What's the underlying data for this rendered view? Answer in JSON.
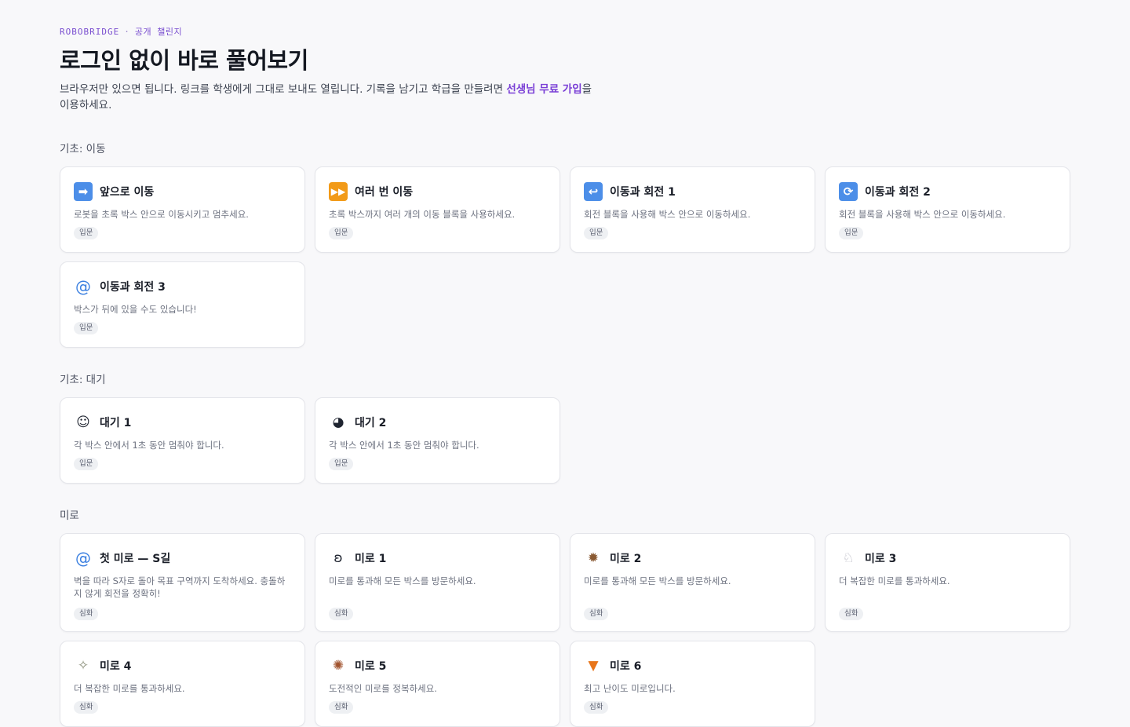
{
  "header": {
    "brand": "ROBOBRIDGE",
    "separator": "·",
    "subtitle": "공개 챌린지",
    "title": "로그인 없이 바로 풀어보기",
    "desc_part1": "브라우저만 있으면 됩니다. 링크를 학생에게 그대로 보내도 열립니다. 기록을 남기고 학급을 만들려면 ",
    "desc_link": "선생님 무료 가입",
    "desc_part2": "을 이용하세요."
  },
  "sections": [
    {
      "title": "기초: 이동",
      "cards": [
        {
          "icon": "right-arrow-icon",
          "glyph": "➡",
          "title": "앞으로 이동",
          "desc": "로봇을 초록 박스 안으로 이동시키고 멈추세요.",
          "badge": "입문"
        },
        {
          "icon": "fast-forward-icon",
          "glyph": "⏩",
          "title": "여러 번 이동",
          "desc": "초록 박스까지 여러 개의 이동 블록을 사용하세요.",
          "badge": "입문"
        },
        {
          "icon": "return-arrow-icon",
          "glyph": "↩",
          "title": "이동과 회전 1",
          "desc": "회전 블록을 사용해 박스 안으로 이동하세요.",
          "badge": "입문"
        },
        {
          "icon": "rotate-arrows-icon",
          "glyph": "🔄",
          "title": "이동과 회전 2",
          "desc": "회전 블록을 사용해 박스 안으로 이동하세요.",
          "badge": "입문"
        },
        {
          "icon": "cyclone-icon",
          "glyph": "🌀",
          "title": "이동과 회전 3",
          "desc": "박스가 뒤에 있을 수도 있습니다!",
          "badge": "입문"
        }
      ]
    },
    {
      "title": "기초: 대기",
      "cards": [
        {
          "icon": "sleeping-face-icon",
          "glyph": "😴",
          "title": "대기 1",
          "desc": "각 박스 안에서 1초 동안 멈춰야 합니다.",
          "badge": "입문"
        },
        {
          "icon": "panda-icon",
          "glyph": "🐼",
          "title": "대기 2",
          "desc": "각 박스 안에서 1초 동안 멈춰야 합니다.",
          "badge": "입문"
        }
      ]
    },
    {
      "title": "미로",
      "cards": [
        {
          "icon": "cyclone-icon",
          "glyph": "🌀",
          "title": "첫 미로 — S길",
          "desc": "벽을 따라 S자로 돌아 목표 구역까지 도착하세요. 충돌하지 않게 회전을 정확히!",
          "badge": "심화"
        },
        {
          "icon": "rabbit-face-icon",
          "glyph": "🐰",
          "title": "미로 1",
          "desc": "미로를 통과해 모든 박스를 방문하세요.",
          "badge": "심화"
        },
        {
          "icon": "hedgehog-icon",
          "glyph": "🦔",
          "title": "미로 2",
          "desc": "미로를 통과해 모든 박스를 방문하세요.",
          "badge": "심화"
        },
        {
          "icon": "rabbit-icon",
          "glyph": "🐇",
          "title": "미로 3",
          "desc": "더 복잡한 미로를 통과하세요.",
          "badge": "심화"
        },
        {
          "icon": "lizard-icon",
          "glyph": "🦎",
          "title": "미로 4",
          "desc": "더 복잡한 미로를 통과하세요.",
          "badge": "심화"
        },
        {
          "icon": "turkey-icon",
          "glyph": "🦃",
          "title": "미로 5",
          "desc": "도전적인 미로를 정복하세요.",
          "badge": "심화"
        },
        {
          "icon": "fox-icon",
          "glyph": "🦊",
          "title": "미로 6",
          "desc": "최고 난이도 미로입니다.",
          "badge": "심화"
        }
      ]
    }
  ]
}
